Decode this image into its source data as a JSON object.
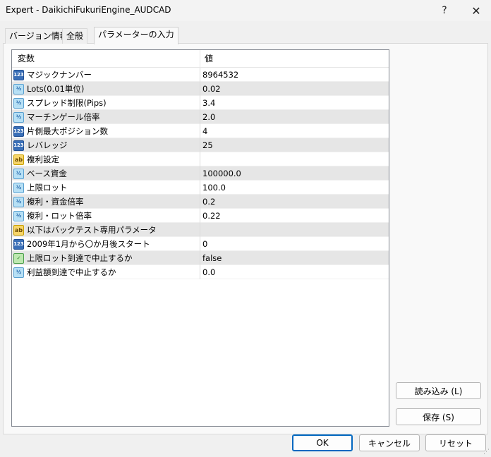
{
  "window": {
    "title": "Expert - DaikichiFukuriEngine_AUDCAD",
    "help_label": "?",
    "close_label": "✕"
  },
  "tabs": [
    {
      "label": "バージョン情報"
    },
    {
      "label": "全般"
    },
    {
      "label": "パラメーターの入力"
    }
  ],
  "grid": {
    "header_variable": "変数",
    "header_value": "値",
    "rows": [
      {
        "icon": "int-icon",
        "icon_text": "123",
        "name": "マジックナンバー",
        "value": "8964532"
      },
      {
        "icon": "double-icon",
        "icon_text": "½",
        "name": "Lots(0.01単位)",
        "value": "0.02"
      },
      {
        "icon": "double-icon",
        "icon_text": "½",
        "name": "スプレッド制限(Pips)",
        "value": "3.4"
      },
      {
        "icon": "double-icon",
        "icon_text": "½",
        "name": "マーチンゲール倍率",
        "value": "2.0"
      },
      {
        "icon": "int-icon",
        "icon_text": "123",
        "name": "片側最大ポジション数",
        "value": "4"
      },
      {
        "icon": "int-icon",
        "icon_text": "123",
        "name": "レバレッジ",
        "value": "25"
      },
      {
        "icon": "string-icon",
        "icon_text": "ab",
        "name": "複利設定",
        "value": ""
      },
      {
        "icon": "double-icon",
        "icon_text": "½",
        "name": "ベース資金",
        "value": "100000.0"
      },
      {
        "icon": "double-icon",
        "icon_text": "½",
        "name": "上限ロット",
        "value": "100.0"
      },
      {
        "icon": "double-icon",
        "icon_text": "½",
        "name": "複利・資金倍率",
        "value": "0.2"
      },
      {
        "icon": "double-icon",
        "icon_text": "½",
        "name": "複利・ロット倍率",
        "value": "0.22"
      },
      {
        "icon": "string-icon",
        "icon_text": "ab",
        "name": "以下はバックテスト専用パラメータ",
        "value": ""
      },
      {
        "icon": "int-icon",
        "icon_text": "123",
        "name": "2009年1月から〇か月後スタート",
        "value": "0"
      },
      {
        "icon": "bool-icon",
        "icon_text": "✓",
        "name": "上限ロット到達で中止するか",
        "value": "false"
      },
      {
        "icon": "double-icon",
        "icon_text": "½",
        "name": "利益額到達で中止するか",
        "value": "0.0"
      }
    ]
  },
  "buttons": {
    "load": "読み込み (L)",
    "save": "保存 (S)",
    "ok": "OK",
    "cancel": "キャンセル",
    "reset": "リセット"
  }
}
